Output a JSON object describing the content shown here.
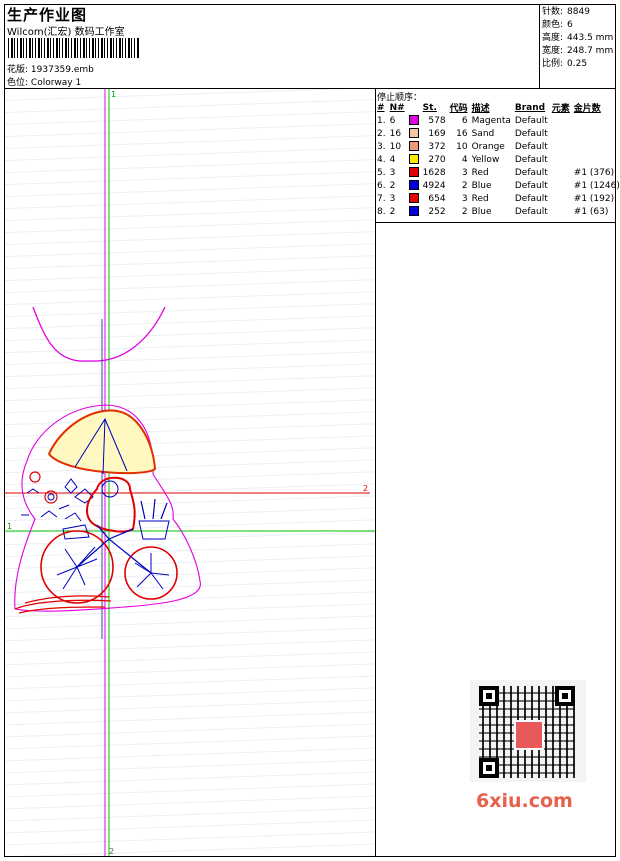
{
  "header": {
    "title": "生产作业图",
    "company": "Wilcom(汇宏) 数码工作室",
    "design_file_label": "花版:",
    "design_file": "1937359.emb",
    "colorway_label": "色位:",
    "colorway": "Colorway 1"
  },
  "stats": {
    "stitches_label": "针数:",
    "stitches": "8849",
    "colors_label": "颜色:",
    "colors": "6",
    "height_label": "高度:",
    "height": "443.5 mm",
    "width_label": "宽度:",
    "width": "248.7 mm",
    "scale_label": "比例:",
    "scale": "0.25"
  },
  "color_sequence": {
    "title": "停止顺序：",
    "headers": {
      "idx": "#",
      "n": "N#",
      "st": "St.",
      "code": "代码",
      "desc": "描述",
      "brand": "Brand",
      "element": "元素",
      "sequin": "金片数"
    },
    "rows": [
      {
        "idx": "1.",
        "n": "6",
        "color": "#e000e0",
        "st": "578",
        "code": "6",
        "desc": "Magenta",
        "brand": "Default",
        "sequin": ""
      },
      {
        "idx": "2.",
        "n": "16",
        "color": "#f2c6a0",
        "st": "169",
        "code": "16",
        "desc": "Sand",
        "brand": "Default",
        "sequin": ""
      },
      {
        "idx": "3.",
        "n": "10",
        "color": "#f0987a",
        "st": "372",
        "code": "10",
        "desc": "Orange",
        "brand": "Default",
        "sequin": ""
      },
      {
        "idx": "4.",
        "n": "4",
        "color": "#f8f000",
        "st": "270",
        "code": "4",
        "desc": "Yellow",
        "brand": "Default",
        "sequin": ""
      },
      {
        "idx": "5.",
        "n": "3",
        "color": "#e00000",
        "st": "1628",
        "code": "3",
        "desc": "Red",
        "brand": "Default",
        "sequin": "#1 (376)"
      },
      {
        "idx": "6.",
        "n": "2",
        "color": "#0000e0",
        "st": "4924",
        "code": "2",
        "desc": "Blue",
        "brand": "Default",
        "sequin": "#1 (1246)"
      },
      {
        "idx": "7.",
        "n": "3",
        "color": "#e00000",
        "st": "654",
        "code": "3",
        "desc": "Red",
        "brand": "Default",
        "sequin": "#1 (192)"
      },
      {
        "idx": "8.",
        "n": "2",
        "color": "#0000e0",
        "st": "252",
        "code": "2",
        "desc": "Blue",
        "brand": "Default",
        "sequin": "#1 (63)"
      }
    ]
  },
  "design": {
    "marker_1": "1",
    "marker_2": "2",
    "marker_top": "1",
    "marker_bottom": "2"
  },
  "watermark": "6xiu.com"
}
